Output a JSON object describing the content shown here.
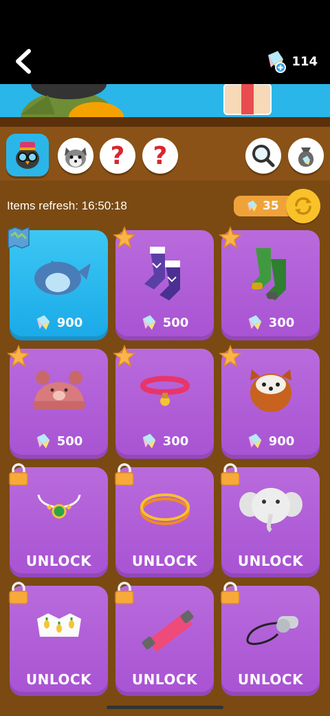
{
  "header": {
    "back_label": "back",
    "gem_count": "114"
  },
  "tabs": [
    {
      "name": "tab-character-owl",
      "icon": "owl-avatar-icon"
    },
    {
      "name": "tab-character-husky",
      "icon": "husky-avatar-icon"
    },
    {
      "name": "tab-unknown-1",
      "label": "?"
    },
    {
      "name": "tab-unknown-2",
      "label": "?"
    }
  ],
  "tools": {
    "search_icon": "search-icon",
    "bag_icon": "gem-bag-icon"
  },
  "refresh": {
    "label": "Items refresh: 16:50:18",
    "cost": "35"
  },
  "items": [
    {
      "price": "900",
      "badge": "map",
      "featured": true
    },
    {
      "price": "500",
      "badge": "star"
    },
    {
      "price": "300",
      "badge": "star"
    },
    {
      "price": "500",
      "badge": "star"
    },
    {
      "price": "300",
      "badge": "star"
    },
    {
      "price": "900",
      "badge": "star"
    },
    {
      "unlock": "UNLOCK",
      "badge": "lock"
    },
    {
      "unlock": "UNLOCK",
      "badge": "lock"
    },
    {
      "unlock": "UNLOCK",
      "badge": "lock"
    },
    {
      "unlock": "UNLOCK",
      "badge": "lock"
    },
    {
      "unlock": "UNLOCK",
      "badge": "lock"
    },
    {
      "unlock": "UNLOCK",
      "badge": "lock"
    }
  ],
  "colors": {
    "card_purple": "#b96bdc",
    "card_featured": "#2ab6e8",
    "background_brown": "#7a4a12",
    "refresh_gold": "#f9c22a"
  }
}
